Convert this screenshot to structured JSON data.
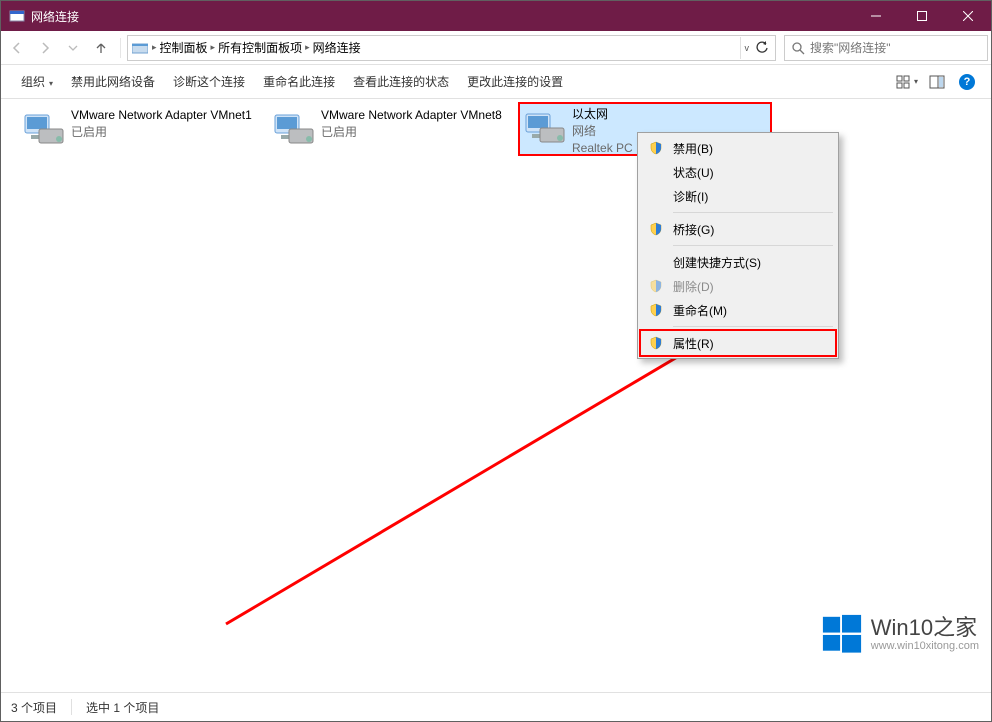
{
  "window": {
    "title": "网络连接",
    "minimize": "—",
    "maximize": "☐",
    "close": "✕"
  },
  "breadcrumbs": {
    "b1": "控制面板",
    "b2": "所有控制面板项",
    "b3": "网络连接"
  },
  "search": {
    "placeholder": "搜索\"网络连接\""
  },
  "toolbar": {
    "organize": "组织",
    "disable": "禁用此网络设备",
    "diagnose": "诊断这个连接",
    "rename": "重命名此连接",
    "viewstatus": "查看此连接的状态",
    "change": "更改此连接的设置"
  },
  "items": [
    {
      "name": "VMware Network Adapter VMnet1",
      "sub1": "已启用",
      "sub2": ""
    },
    {
      "name": "VMware Network Adapter VMnet8",
      "sub1": "已启用",
      "sub2": ""
    },
    {
      "name": "以太网",
      "sub1": "网络",
      "sub2": "Realtek PC"
    }
  ],
  "context_menu": {
    "disable": "禁用(B)",
    "status": "状态(U)",
    "diagnose": "诊断(I)",
    "bridge": "桥接(G)",
    "shortcut": "创建快捷方式(S)",
    "delete": "删除(D)",
    "rename": "重命名(M)",
    "properties": "属性(R)"
  },
  "statusbar": {
    "count": "3 个项目",
    "selected": "选中 1 个项目"
  },
  "watermark": {
    "brand_en": "Win10",
    "brand_cn": "之家",
    "url": "www.win10xitong.com"
  }
}
